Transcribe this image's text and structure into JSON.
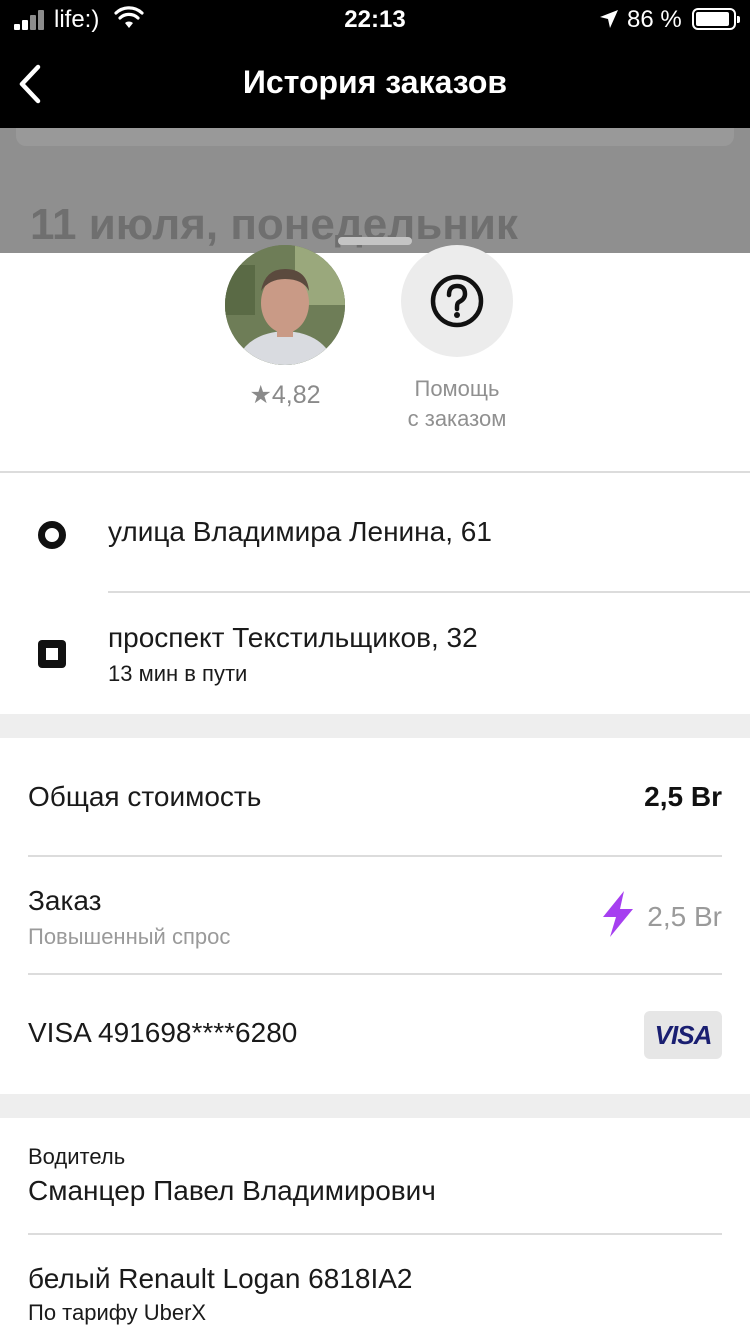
{
  "status_bar": {
    "carrier": "life:)",
    "time": "22:13",
    "battery_percent": "86 %"
  },
  "nav": {
    "title": "История заказов"
  },
  "backdrop": {
    "date_heading": "11 июля, понедельник"
  },
  "driver_summary": {
    "rating": "★4,82",
    "help_line1": "Помощь",
    "help_line2": "с заказом"
  },
  "route": {
    "pickup": "улица Владимира Ленина, 61",
    "dropoff": "проспект Текстильщиков, 32",
    "duration": "13 мин в пути"
  },
  "payment": {
    "total_label": "Общая стоимость",
    "total_value": "2,5 Br",
    "order_label": "Заказ",
    "order_sub": "Повышенный спрос",
    "order_value": "2,5 Br",
    "card": "VISA 491698****6280",
    "card_brand": "VISA",
    "surge_color": "#a63ff0"
  },
  "driver": {
    "label": "Водитель",
    "name": "Сманцер Павел Владимирович",
    "car": "белый Renault Logan 6818IA2",
    "tariff": "По тарифу UberX"
  },
  "icons": {
    "back": "chevron-left-icon",
    "help": "question-circle-icon",
    "surge": "lightning-bolt-icon",
    "pickup": "circle-marker-icon",
    "dropoff": "square-marker-icon"
  }
}
